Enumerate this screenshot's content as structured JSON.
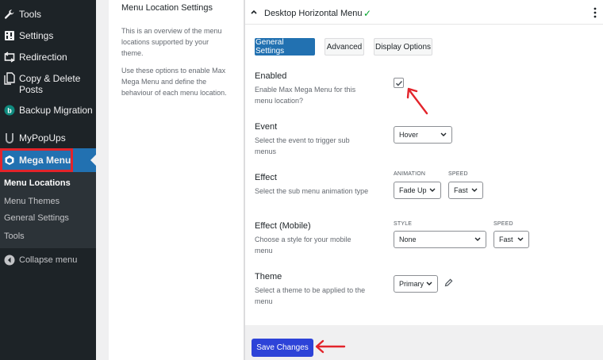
{
  "sidebar": {
    "items": [
      {
        "label": "Tools",
        "icon": "wrench-icon"
      },
      {
        "label": "Settings",
        "icon": "sliders-icon"
      },
      {
        "label": "Redirection",
        "icon": "redirect-icon"
      },
      {
        "label": "Copy & Delete Posts",
        "icon": "copy-icon"
      },
      {
        "label": "Backup Migration",
        "icon": "backup-icon"
      },
      {
        "label": "MyPopUps",
        "icon": "mypopups-icon"
      },
      {
        "label": "Mega Menu",
        "icon": "cube-icon"
      }
    ],
    "submenu": [
      "Menu Locations",
      "Menu Themes",
      "General Settings",
      "Tools"
    ],
    "collapse_label": "Collapse menu",
    "colors": {
      "bg": "#1d2327",
      "active": "#2271b1",
      "highlight": "#e3242b"
    }
  },
  "left_panel": {
    "title": "Menu Location Settings",
    "p1": "This is an overview of the menu locations supported by your theme.",
    "p2": "Use these options to enable Max Mega Menu and define the behaviour of each menu location."
  },
  "main": {
    "header_title": "Desktop Horizontal Menu",
    "header_check": "✓",
    "tabs": [
      "General Settings",
      "Advanced",
      "Display Options"
    ],
    "fields": {
      "enabled": {
        "label": "Enabled",
        "desc": "Enable Max Mega Menu for this menu location?",
        "checked": true
      },
      "event": {
        "label": "Event",
        "desc": "Select the event to trigger sub menus",
        "value": "Hover"
      },
      "effect": {
        "label": "Effect",
        "desc": "Select the sub menu animation type",
        "animation_label": "ANIMATION",
        "speed_label": "SPEED",
        "animation_value": "Fade Up",
        "speed_value": "Fast"
      },
      "effect_mobile": {
        "label": "Effect (Mobile)",
        "desc": "Choose a style for your mobile menu",
        "style_label": "STYLE",
        "speed_label": "SPEED",
        "style_value": "None",
        "speed_value": "Fast"
      },
      "theme": {
        "label": "Theme",
        "desc": "Select a theme to be applied to the menu",
        "value": "Primary"
      }
    },
    "save_label": "Save Changes"
  },
  "colors": {
    "accent": "#2271b1",
    "save": "#2d43d8",
    "check": "#00a32a",
    "annotation": "#e3242b"
  }
}
